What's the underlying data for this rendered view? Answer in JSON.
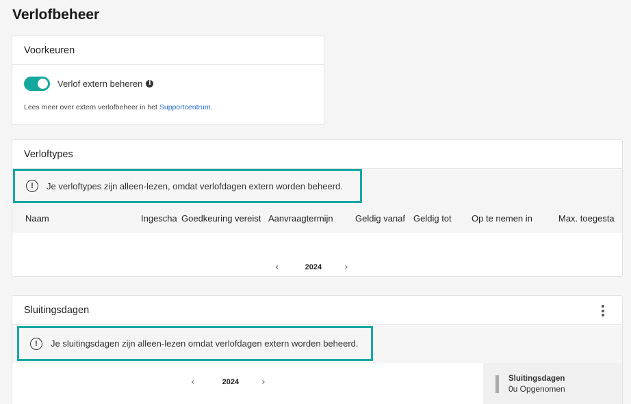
{
  "page": {
    "title": "Verlofbeheer"
  },
  "preferences": {
    "title": "Voorkeuren",
    "toggle_label": "Verlof extern beheren",
    "toggle_on": true,
    "support_prefix": "Lees meer over extern verlofbeheer in het ",
    "support_link": "Supportcentrum",
    "support_suffix": "."
  },
  "leave_types": {
    "title": "Verloftypes",
    "alert": "Je verloftypes zijn alleen-lezen, omdat verlofdagen extern worden beheerd.",
    "columns": [
      "Naam",
      "Ingescha",
      "Goedkeuring vereist",
      "Aanvraagtermijn",
      "Geldig vanaf",
      "Geldig tot",
      "Op te nemen in",
      "Max. toegesta"
    ],
    "year": "2024"
  },
  "closing_days": {
    "title": "Sluitingsdagen",
    "alert": "Je sluitingsdagen zijn alleen-lezen omdat verlofdagen extern worden beheerd.",
    "year": "2024",
    "summary_title": "Sluitingsdagen",
    "summary_value": "0u Opgenomen"
  },
  "colors": {
    "accent": "#14a79d",
    "link": "#2a6fd1",
    "alert_border": "#17a8a4"
  }
}
